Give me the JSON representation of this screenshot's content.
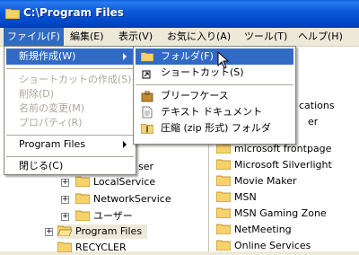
{
  "window": {
    "title": "C:\\Program Files"
  },
  "menubar": [
    {
      "label": "ファイル(F)",
      "active": true
    },
    {
      "label": "編集(E)"
    },
    {
      "label": "表示(V)"
    },
    {
      "label": "お気に入り(A)"
    },
    {
      "label": "ツール(T)"
    },
    {
      "label": "ヘルプ(H)"
    }
  ],
  "file_menu": {
    "new": "新規作成(W)",
    "create_shortcut": "ショートカットの作成(S)",
    "delete": "削除(D)",
    "rename": "名前の変更(M)",
    "properties": "プロパティ(R)",
    "recent": "Program Files",
    "close": "閉じる(C)"
  },
  "new_submenu": {
    "folder": "フォルダ(F)",
    "shortcut": "ショートカット(S)",
    "briefcase": "ブリーフケース",
    "text_document": "テキスト ドキュメント",
    "zip_folder": "圧縮 (zip 形式) フォルダ"
  },
  "tree": {
    "partial_user": "ser",
    "local_service": "LocalService",
    "network_service": "NetworkService",
    "users": "ユーザー",
    "program_files": "Program Files",
    "recycler": "RECYCLER"
  },
  "files": {
    "partial_1": "cations",
    "partial_2": "er",
    "items": [
      "microsoft frontpage",
      "Microsoft Silverlight",
      "Movie Maker",
      "MSN",
      "MSN Gaming Zone",
      "NetMeeting",
      "Online Services"
    ]
  },
  "colors": {
    "highlight": "#316ac5",
    "folder": "#f5d36a",
    "titlebar": "#0a5fd8"
  }
}
